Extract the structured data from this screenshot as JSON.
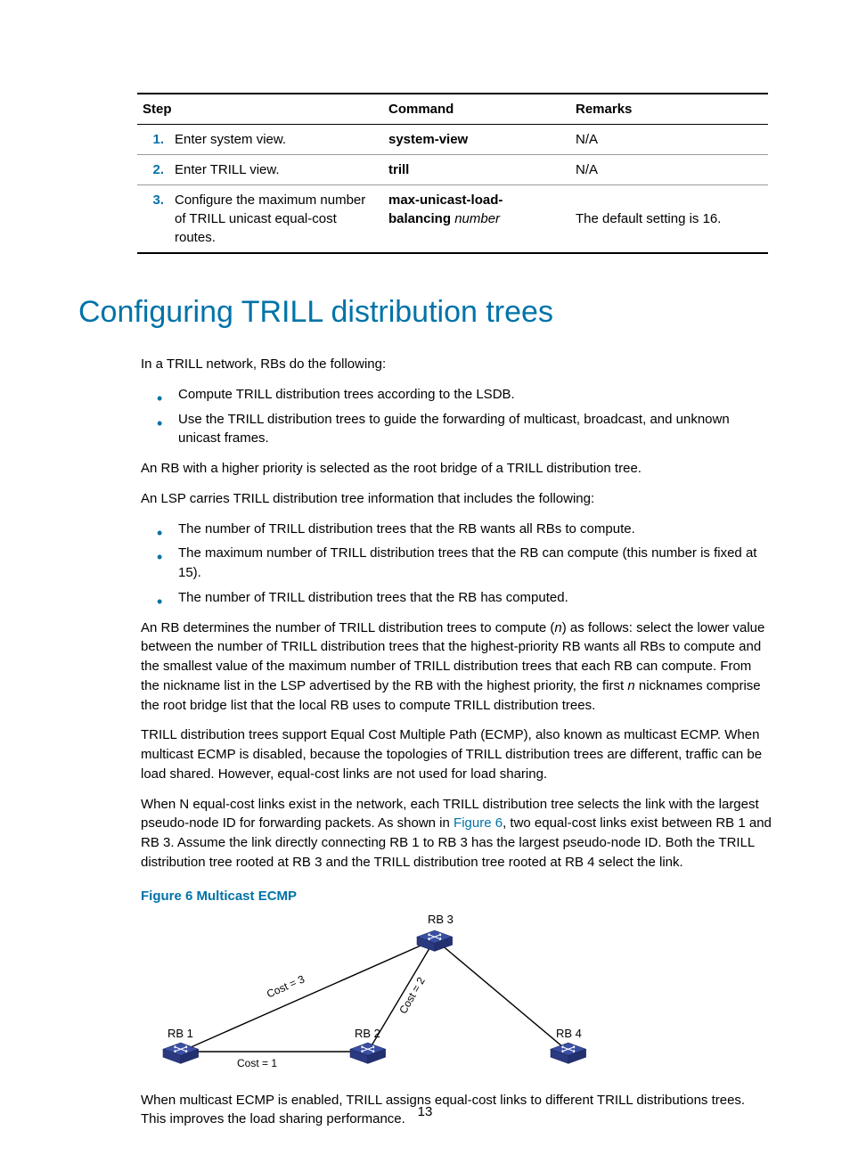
{
  "table": {
    "headers": {
      "step": "Step",
      "command": "Command",
      "remarks": "Remarks"
    },
    "rows": [
      {
        "num": "1.",
        "action": "Enter system view.",
        "cmd": "system-view",
        "cmd_arg": "",
        "remarks": "N/A"
      },
      {
        "num": "2.",
        "action": "Enter TRILL view.",
        "cmd": "trill",
        "cmd_arg": "",
        "remarks": "N/A"
      },
      {
        "num": "3.",
        "action": "Configure the maximum number of TRILL unicast equal-cost routes.",
        "cmd": "max-unicast-load-balancing",
        "cmd_arg": "number",
        "remarks": "The default setting is 16."
      }
    ]
  },
  "heading": "Configuring TRILL distribution trees",
  "intro": "In a TRILL network, RBs do the following:",
  "bullets1": [
    "Compute TRILL distribution trees according to the LSDB.",
    "Use the TRILL distribution trees to guide the forwarding of multicast, broadcast, and unknown unicast frames."
  ],
  "para_rb_priority": "An RB with a higher priority is selected as the root bridge of a TRILL distribution tree.",
  "para_lsp_intro": "An LSP carries TRILL distribution tree information that includes the following:",
  "bullets2": [
    "The number of TRILL distribution trees that the RB wants all RBs to compute.",
    "The maximum number of TRILL distribution trees that the RB can compute (this number is fixed at 15).",
    "The number of TRILL distribution trees that the RB has computed."
  ],
  "para_determine_pre": "An RB determines the number of TRILL distribution trees to compute (",
  "para_determine_n1": "n",
  "para_determine_mid": ") as follows: select the lower value between the number of TRILL distribution trees that the highest-priority RB wants all RBs to compute and the smallest value of the maximum number of TRILL distribution trees that each RB can compute. From the nickname list in the LSP advertised by the RB with the highest priority, the first ",
  "para_determine_n2": "n",
  "para_determine_post": " nicknames comprise the root bridge list that the local RB uses to compute TRILL distribution trees.",
  "para_ecmp": "TRILL distribution trees support Equal Cost Multiple Path (ECMP), also known as multicast ECMP. When multicast ECMP is disabled, because the topologies of TRILL distribution trees are different, traffic can be load shared. However, equal-cost links are not used for load sharing.",
  "para_nlinks_pre": "When N equal-cost links exist in the network, each TRILL distribution tree selects the link with the largest pseudo-node ID for forwarding packets. As shown in ",
  "para_nlinks_link": "Figure 6",
  "para_nlinks_post": ", two equal-cost links exist between RB 1 and RB 3. Assume the link directly connecting RB 1 to RB 3 has the largest pseudo-node ID. Both the TRILL distribution tree rooted at RB 3 and the TRILL distribution tree rooted at RB 4 select the link.",
  "figure_caption": "Figure 6 Multicast ECMP",
  "figure": {
    "rb1": "RB 1",
    "rb2": "RB 2",
    "rb3": "RB 3",
    "rb4": "RB 4",
    "cost3": "Cost = 3",
    "cost2": "Cost = 2",
    "cost1": "Cost = 1"
  },
  "para_enabled": "When multicast ECMP is enabled, TRILL assigns equal-cost links to different TRILL distributions trees. This improves the load sharing performance.",
  "pagenum": "13"
}
